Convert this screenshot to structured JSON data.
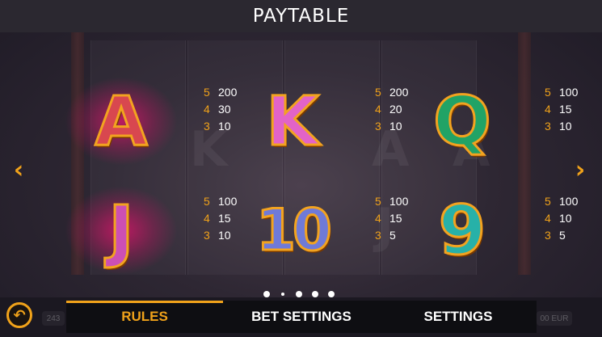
{
  "header": {
    "title": "PAYTABLE"
  },
  "symbols": [
    {
      "glyph": "A",
      "fill": "#d8474f",
      "glow": true,
      "pays": [
        {
          "count": "5",
          "amount": "200"
        },
        {
          "count": "4",
          "amount": "30"
        },
        {
          "count": "3",
          "amount": "10"
        }
      ]
    },
    {
      "glyph": "K",
      "fill": "#e263c8",
      "glow": false,
      "pays": [
        {
          "count": "5",
          "amount": "200"
        },
        {
          "count": "4",
          "amount": "20"
        },
        {
          "count": "3",
          "amount": "10"
        }
      ]
    },
    {
      "glyph": "Q",
      "fill": "#21a366",
      "glow": false,
      "pays": [
        {
          "count": "5",
          "amount": "100"
        },
        {
          "count": "4",
          "amount": "15"
        },
        {
          "count": "3",
          "amount": "10"
        }
      ]
    },
    {
      "glyph": "J",
      "fill": "#cc4fb4",
      "glow": true,
      "pays": [
        {
          "count": "5",
          "amount": "100"
        },
        {
          "count": "4",
          "amount": "15"
        },
        {
          "count": "3",
          "amount": "10"
        }
      ]
    },
    {
      "glyph": "10",
      "fill": "#6f7ad8",
      "glow": false,
      "pays": [
        {
          "count": "5",
          "amount": "100"
        },
        {
          "count": "4",
          "amount": "15"
        },
        {
          "count": "3",
          "amount": "5"
        }
      ]
    },
    {
      "glyph": "9",
      "fill": "#27b1a8",
      "glow": false,
      "pays": [
        {
          "count": "5",
          "amount": "100"
        },
        {
          "count": "4",
          "amount": "10"
        },
        {
          "count": "3",
          "amount": "5"
        }
      ]
    }
  ],
  "navigation": {
    "prev_icon": "chevron-left-icon",
    "next_icon": "chevron-right-icon",
    "pages": 5,
    "current_page": 2
  },
  "tabs": [
    {
      "label": "RULES",
      "active": true
    },
    {
      "label": "BET SETTINGS",
      "active": false
    },
    {
      "label": "SETTINGS",
      "active": false
    }
  ],
  "background": {
    "left_value": "243",
    "right_value": "00 EUR"
  },
  "back_button": {
    "icon": "back-arrow-icon"
  },
  "colors": {
    "accent": "#f0a21a",
    "header_bg": "#2b2830",
    "tab_bar_bg": "#0e0e12"
  }
}
